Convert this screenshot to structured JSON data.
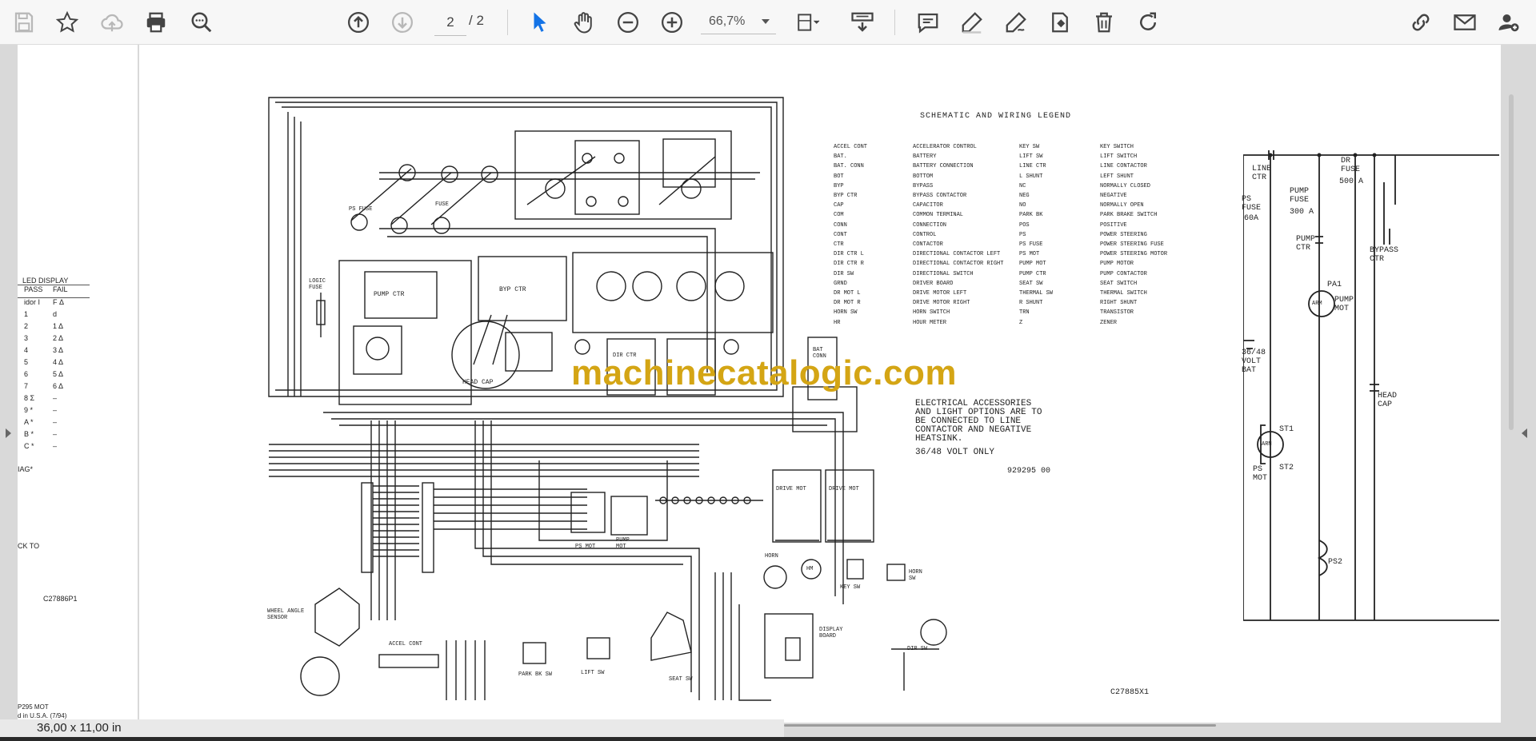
{
  "toolbar": {
    "page_current": "2",
    "page_total": "/ 2",
    "zoom": "66,7%"
  },
  "status": {
    "page_size": "36,00 x 11,00 in"
  },
  "watermark": "machinecatalogic.com",
  "legend": {
    "title": "SCHEMATIC AND WIRING LEGEND",
    "abbr1": [
      "ACCEL CONT",
      "BAT.",
      "BAT. CONN",
      "BOT",
      "BYP",
      "BYP CTR",
      "CAP",
      "COM",
      "CONN",
      "CONT",
      "CTR",
      "DIR CTR L",
      "DIR CTR R",
      "DIR SW",
      "GRND",
      "DR MOT L",
      "DR MOT R",
      "HORN SW",
      "HR"
    ],
    "desc1": [
      "ACCELERATOR CONTROL",
      "BATTERY",
      "BATTERY CONNECTION",
      "BOTTOM",
      "BYPASS",
      "BYPASS CONTACTOR",
      "CAPACITOR",
      "COMMON TERMINAL",
      "CONNECTION",
      "CONTROL",
      "CONTACTOR",
      "DIRECTIONAL CONTACTOR LEFT",
      "DIRECTIONAL CONTACTOR RIGHT",
      "DIRECTIONAL SWITCH",
      "DRIVER BOARD",
      "DRIVE MOTOR LEFT",
      "DRIVE MOTOR RIGHT",
      "HORN SWITCH",
      "HOUR METER"
    ],
    "abbr2": [
      "KEY SW",
      "LIFT SW",
      "LINE CTR",
      "L SHUNT",
      "NC",
      "NEG",
      "NO",
      "PARK BK",
      "POS",
      "PS",
      "PS FUSE",
      "PS MOT",
      "PUMP MOT",
      "PUMP CTR",
      "SEAT SW",
      "THERMAL SW",
      "R SHUNT",
      "TRN",
      "Z"
    ],
    "desc2": [
      "KEY SWITCH",
      "LIFT SWITCH",
      "LINE CONTACTOR",
      "LEFT SHUNT",
      "NORMALLY CLOSED",
      "NEGATIVE",
      "NORMALLY OPEN",
      "PARK BRAKE SWITCH",
      "POSITIVE",
      "POWER STEERING",
      "POWER STEERING FUSE",
      "POWER STEERING MOTOR",
      "PUMP MOTOR",
      "PUMP CONTACTOR",
      "SEAT SWITCH",
      "THERMAL SWITCH",
      "RIGHT SHUNT",
      "TRANSISTOR",
      "ZENER"
    ]
  },
  "note": "ELECTRICAL ACCESSORIES\nAND LIGHT OPTIONS ARE TO\nBE CONNECTED TO LINE\nCONTACTOR AND NEGATIVE\nHEATSINK.",
  "note_volt": "36/48 VOLT ONLY",
  "drawing_no": "929295 00",
  "drawing_code": "C27885X1",
  "left_page": {
    "title": "LED DISPLAY",
    "head_pass": "PASS",
    "head_fail": "FAIL",
    "rows": [
      [
        "idor I",
        "F Δ"
      ],
      [
        "1",
        "d"
      ],
      [
        "2",
        "1 Δ"
      ],
      [
        "3",
        "2 Δ"
      ],
      [
        "4",
        "3 Δ"
      ],
      [
        "5",
        "4 Δ"
      ],
      [
        "6",
        "5 Δ"
      ],
      [
        "7",
        "6 Δ"
      ],
      [
        "8 Σ",
        "–"
      ],
      [
        "9 *",
        "–"
      ],
      [
        "A *",
        "–"
      ],
      [
        "B *",
        "–"
      ],
      [
        "C *",
        "–"
      ]
    ],
    "diag": "IAG*",
    "back": "CK TO",
    "code": "C27886P1",
    "foot1": "P295 MOT",
    "foot2": "d in U.S.A. (7/94)"
  },
  "labels": {
    "head_cap": "HEAD CAP",
    "pump_ctr": "PUMP CTR",
    "byp_ctr": "BYP CTR",
    "logic_fuse": "LOGIC FUSE",
    "dir_ctr": "DIR CTR",
    "bat_conn": "BAT CONN",
    "ps_mot": "PS MOT",
    "pump_mot": "PUMP MOT",
    "drive_mot": "DRIVE MOT",
    "horn": "HORN",
    "hm": "HM",
    "key_sw": "KEY SW",
    "horn_sw": "HORN SW",
    "wheel_sensor": "WHEEL ANGLE SENSOR",
    "accel_cont": "ACCEL CONT",
    "park_bk_sw": "PARK BK SW",
    "lift_sw": "LIFT SW",
    "seat_sw": "SEAT SW",
    "display_board": "DISPLAY BOARD",
    "dir_sw": "DIR SW",
    "ps_fuse": "PS FUSE",
    "lfuse": "FUSE",
    "rfuse": "FUSE"
  },
  "schematic": {
    "line_ctr": "LINE CTR",
    "dr_fuse": "DR FUSE",
    "dr_fuse_val": "500 A",
    "ps_fuse": "PS FUSE",
    "ps_fuse_val": "60A",
    "pump_fuse": "PUMP FUSE",
    "pump_fuse_val": "300 A",
    "pump_ctr": "PUMP CTR",
    "bypass_ctr": "BYPASS CTR",
    "pa1": "PA1",
    "pump_mot": "PUMP MOT",
    "arm": "ARM",
    "bat": "36/48 VOLT BAT",
    "head_cap": "HEAD CAP",
    "st1": "ST1",
    "st2": "ST2",
    "ps_mot": "PS MOT",
    "ps2": "PS2"
  }
}
